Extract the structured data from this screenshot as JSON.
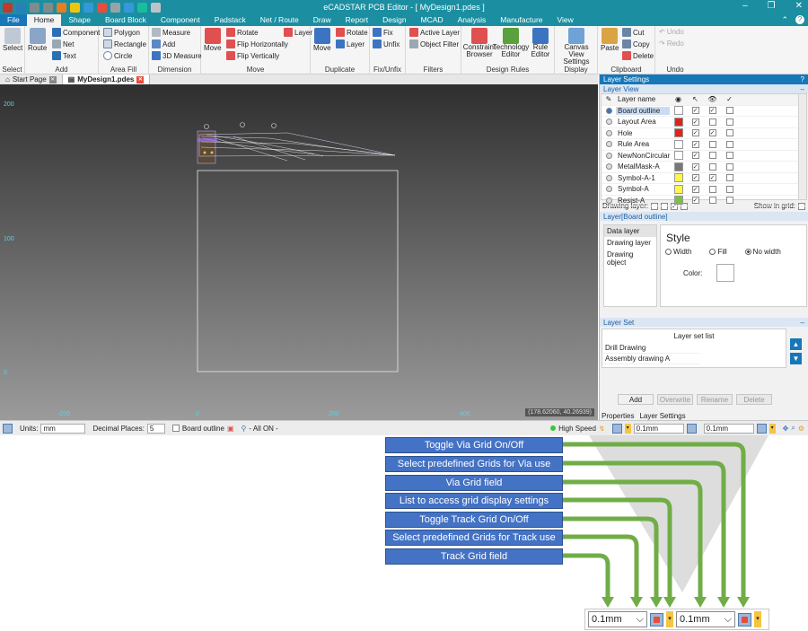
{
  "window": {
    "title": "eCADSTAR PCB Editor - [ MyDesign1.pdes ]",
    "minimize": "–",
    "maximize": "❐",
    "close": "✕"
  },
  "menu": {
    "tabs": [
      "File",
      "Home",
      "Shape",
      "Board Block",
      "Component",
      "Padstack",
      "Net / Route",
      "Draw",
      "Report",
      "Design",
      "MCAD",
      "Analysis",
      "Manufacture",
      "View"
    ],
    "active": "Home",
    "help": "?"
  },
  "ribbon": {
    "groups": {
      "select": "Select",
      "add": "Add",
      "area_fill": "Area Fill",
      "dimension": "Dimension",
      "move": "Move",
      "duplicate": "Duplicate",
      "fixunfix": "Fix/Unfix",
      "filters": "Filters",
      "design_rules": "Design Rules",
      "display": "Display",
      "clipboard": "Clipboard",
      "undo": "Undo"
    },
    "buttons": {
      "select": "Select",
      "route": "Route",
      "component": "Component",
      "net": "Net",
      "text": "Text",
      "polygon": "Polygon",
      "rectangle": "Rectangle",
      "circle": "Circle",
      "measure": "Measure",
      "add": "Add",
      "measure3d": "3D Measure",
      "move": "Move",
      "rotate": "Rotate",
      "flip_h": "Flip Horizontally",
      "flip_v": "Flip Vertically",
      "layer": "Layer",
      "dup_move": "Move",
      "dup_rotate": "Rotate",
      "dup_layer": "Layer",
      "fix": "Fix",
      "unfix": "Unfix",
      "active_layer": "Active Layer",
      "object_filter": "Object Filter",
      "constraint_browser": "Constraint Browser",
      "technology_editor": "Technology Editor",
      "rule_editor": "Rule Editor",
      "canvas_view_settings": "Canvas View Settings",
      "paste": "Paste",
      "cut": "Cut",
      "copy": "Copy",
      "delete": "Delete",
      "undo": "Undo",
      "redo": "Redo"
    }
  },
  "doc_tabs": [
    {
      "label": "Start Page"
    },
    {
      "label": "MyDesign1.pdes"
    }
  ],
  "canvas": {
    "y_labels": [
      "200",
      "100",
      "0"
    ],
    "x_labels": [
      "-200",
      "0",
      "200",
      "400"
    ],
    "coordinate": "(178.62060, 40.26939)"
  },
  "layer_settings": {
    "title": "Layer Settings",
    "layer_view_title": "Layer View",
    "column_header": "Layer name",
    "layers": [
      {
        "name": "Board outline",
        "color": "#ffffff"
      },
      {
        "name": "Layout Area",
        "color": "#e0241c"
      },
      {
        "name": "Hole",
        "color": "#e0241c"
      },
      {
        "name": "Rule Area",
        "color": "#ffffff"
      },
      {
        "name": "NewNonCircularHole",
        "color": "#ffffff"
      },
      {
        "name": "MetalMask-A",
        "color": "#777777"
      },
      {
        "name": "Symbol-A-1",
        "color": "#fff64a"
      },
      {
        "name": "Symbol-A",
        "color": "#fff64a"
      },
      {
        "name": "Resist-A",
        "color": "#7ac143"
      }
    ],
    "drawing_layer_label": "Drawing layer:",
    "show_in_grid_label": "Show in grid:",
    "board_outline_title": "Layer[Board outline]",
    "style_list": [
      "Data layer",
      "Drawing layer",
      "Drawing object"
    ],
    "style_title": "Style",
    "width_label": "Width",
    "fill_label": "Fill",
    "no_width_label": "No width",
    "color_label": "Color:",
    "layer_set_title": "Layer Set",
    "layer_set_header": "Layer set list",
    "layer_set_items": [
      "Drill Drawing",
      "Assembly drawing A"
    ],
    "buttons": {
      "add": "Add",
      "overwrite": "Overwrite",
      "rename": "Rename",
      "delete": "Delete"
    },
    "bottom_tabs": [
      "Properties",
      "Layer Settings"
    ]
  },
  "status": {
    "units_label": "Units:",
    "units_value": "mm",
    "decimal_label": "Decimal Places:",
    "decimal_value": "5",
    "board_outline": "Board outline",
    "all_on": "- All ON -",
    "high_speed": "High Speed",
    "via_grid": "0.1mm",
    "track_grid": "0.1mm"
  },
  "callouts": [
    "Toggle Via Grid On/Off",
    "Select predefined Grids for Via use",
    "Via Grid field",
    "List to access grid display settings",
    "Toggle Track Grid On/Off",
    "Select predefined Grids for Track use",
    "Track Grid field"
  ],
  "zoom": {
    "track_grid": "0.1mm",
    "via_grid": "0.1mm"
  }
}
